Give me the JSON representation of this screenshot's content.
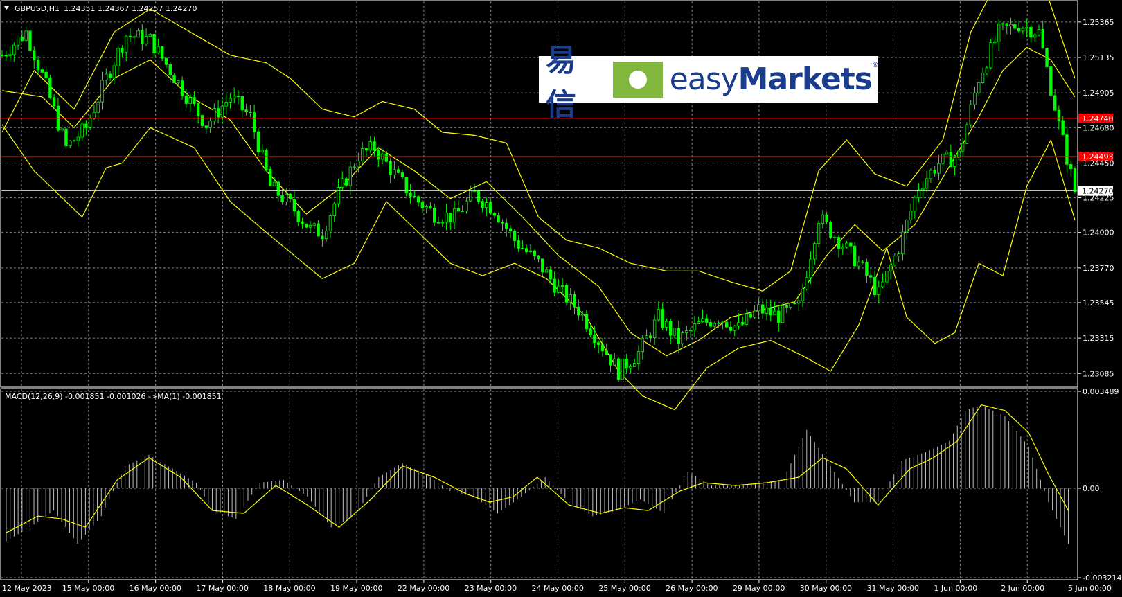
{
  "chart_data": [
    {
      "type": "candlestick",
      "symbol_header": "GBPUSD,H1",
      "ohlc": "1.24351 1.24367 1.24257 1.24270",
      "y_ticks": [
        "1.25365",
        "1.25135",
        "1.24905",
        "1.24680",
        "1.24450",
        "1.24225",
        "1.24000",
        "1.23770",
        "1.23545",
        "1.23315",
        "1.23085"
      ],
      "ylim": [
        1.2301,
        1.2549
      ],
      "x_ticks": [
        "12 May 2023",
        "15 May 00:00",
        "16 May 00:00",
        "17 May 00:00",
        "18 May 00:00",
        "19 May 00:00",
        "22 May 00:00",
        "23 May 00:00",
        "24 May 00:00",
        "25 May 00:00",
        "26 May 00:00",
        "29 May 00:00",
        "30 May 00:00",
        "31 May 00:00",
        "1 Jun 00:00",
        "2 Jun 00:00",
        "5 Jun 00:00"
      ],
      "hlines": [
        {
          "value": 1.2474,
          "label": "1.24740",
          "color": "#ff0000"
        },
        {
          "value": 1.24493,
          "label": "1.24493",
          "color": "#ff0000"
        },
        {
          "value": 1.2427,
          "label": "1.24270",
          "color": "#c0c0c0"
        }
      ],
      "close_path": [
        [
          0,
          1.2515
        ],
        [
          6,
          1.253
        ],
        [
          11,
          1.2495
        ],
        [
          16,
          1.2455
        ],
        [
          21,
          1.2468
        ],
        [
          26,
          1.25
        ],
        [
          31,
          1.2528
        ],
        [
          37,
          1.2525
        ],
        [
          42,
          1.2505
        ],
        [
          47,
          1.2485
        ],
        [
          51,
          1.247
        ],
        [
          57,
          1.2488
        ],
        [
          62,
          1.2475
        ],
        [
          67,
          1.243
        ],
        [
          72,
          1.2418
        ],
        [
          77,
          1.2402
        ],
        [
          80,
          1.24
        ],
        [
          84,
          1.2425
        ],
        [
          89,
          1.245
        ],
        [
          93,
          1.2455
        ],
        [
          98,
          1.2438
        ],
        [
          103,
          1.2422
        ],
        [
          108,
          1.2412
        ],
        [
          113,
          1.241
        ],
        [
          118,
          1.2425
        ],
        [
          123,
          1.2415
        ],
        [
          128,
          1.2395
        ],
        [
          134,
          1.238
        ],
        [
          139,
          1.2363
        ],
        [
          144,
          1.235
        ],
        [
          149,
          1.233
        ],
        [
          154,
          1.231
        ],
        [
          159,
          1.2322
        ],
        [
          164,
          1.2345
        ],
        [
          169,
          1.233
        ],
        [
          174,
          1.234
        ],
        [
          179,
          1.2345
        ],
        [
          184,
          1.2338
        ],
        [
          189,
          1.235
        ],
        [
          194,
          1.2346
        ],
        [
          199,
          1.2352
        ],
        [
          204,
          1.241
        ],
        [
          209,
          1.2395
        ],
        [
          214,
          1.238
        ],
        [
          219,
          1.236
        ],
        [
          224,
          1.239
        ],
        [
          229,
          1.243
        ],
        [
          234,
          1.2445
        ],
        [
          239,
          1.245
        ],
        [
          244,
          1.25
        ],
        [
          249,
          1.253
        ],
        [
          254,
          1.2535
        ],
        [
          259,
          1.253
        ],
        [
          264,
          1.247
        ],
        [
          268,
          1.2427
        ]
      ],
      "bb_upper": [
        [
          0,
          1.2465
        ],
        [
          8,
          1.2505
        ],
        [
          18,
          1.248
        ],
        [
          28,
          1.253
        ],
        [
          37,
          1.2545
        ],
        [
          47,
          1.253
        ],
        [
          57,
          1.2515
        ],
        [
          66,
          1.251
        ],
        [
          72,
          1.25
        ],
        [
          80,
          1.248
        ],
        [
          88,
          1.2475
        ],
        [
          95,
          1.2485
        ],
        [
          103,
          1.248
        ],
        [
          110,
          1.2465
        ],
        [
          118,
          1.2463
        ],
        [
          126,
          1.2458
        ],
        [
          134,
          1.241
        ],
        [
          141,
          1.2395
        ],
        [
          149,
          1.239
        ],
        [
          157,
          1.238
        ],
        [
          166,
          1.2375
        ],
        [
          174,
          1.2375
        ],
        [
          182,
          1.2368
        ],
        [
          190,
          1.2362
        ],
        [
          197,
          1.2375
        ],
        [
          204,
          1.244
        ],
        [
          211,
          1.246
        ],
        [
          218,
          1.2438
        ],
        [
          226,
          1.243
        ],
        [
          235,
          1.246
        ],
        [
          242,
          1.253
        ],
        [
          248,
          1.256
        ],
        [
          255,
          1.258
        ],
        [
          261,
          1.2555
        ],
        [
          268,
          1.25
        ]
      ],
      "bb_middle": [
        [
          0,
          1.2492
        ],
        [
          10,
          1.2488
        ],
        [
          18,
          1.2468
        ],
        [
          28,
          1.25
        ],
        [
          37,
          1.2512
        ],
        [
          47,
          1.2488
        ],
        [
          57,
          1.2473
        ],
        [
          66,
          1.244
        ],
        [
          76,
          1.2412
        ],
        [
          85,
          1.243
        ],
        [
          94,
          1.2455
        ],
        [
          103,
          1.244
        ],
        [
          112,
          1.2422
        ],
        [
          121,
          1.2433
        ],
        [
          130,
          1.241
        ],
        [
          139,
          1.2385
        ],
        [
          149,
          1.2365
        ],
        [
          157,
          1.2335
        ],
        [
          166,
          1.232
        ],
        [
          174,
          1.233
        ],
        [
          182,
          1.2345
        ],
        [
          190,
          1.235
        ],
        [
          198,
          1.2355
        ],
        [
          206,
          1.2385
        ],
        [
          213,
          1.2405
        ],
        [
          220,
          1.2388
        ],
        [
          228,
          1.2405
        ],
        [
          236,
          1.244
        ],
        [
          244,
          1.2475
        ],
        [
          250,
          1.2505
        ],
        [
          256,
          1.252
        ],
        [
          262,
          1.2512
        ],
        [
          268,
          1.2488
        ]
      ],
      "bb_lower": [
        [
          0,
          1.247
        ],
        [
          8,
          1.244
        ],
        [
          20,
          1.241
        ],
        [
          26,
          1.2442
        ],
        [
          30,
          1.2445
        ],
        [
          37,
          1.2468
        ],
        [
          48,
          1.2455
        ],
        [
          57,
          1.242
        ],
        [
          66,
          1.24
        ],
        [
          80,
          1.237
        ],
        [
          88,
          1.238
        ],
        [
          96,
          1.242
        ],
        [
          104,
          1.24
        ],
        [
          112,
          1.238
        ],
        [
          120,
          1.2372
        ],
        [
          128,
          1.238
        ],
        [
          136,
          1.237
        ],
        [
          146,
          1.2345
        ],
        [
          154,
          1.231
        ],
        [
          160,
          1.2294
        ],
        [
          168,
          1.2285
        ],
        [
          176,
          1.2312
        ],
        [
          184,
          1.2325
        ],
        [
          192,
          1.233
        ],
        [
          200,
          1.232
        ],
        [
          207,
          1.231
        ],
        [
          214,
          1.234
        ],
        [
          221,
          1.239
        ],
        [
          226,
          1.2345
        ],
        [
          233,
          1.2328
        ],
        [
          238,
          1.2335
        ],
        [
          244,
          1.238
        ],
        [
          250,
          1.2372
        ],
        [
          256,
          1.243
        ],
        [
          262,
          1.246
        ],
        [
          268,
          1.2408
        ]
      ]
    },
    {
      "type": "histogram",
      "label": "MACD(12,26,9) -0.001851 -0.001026  ->MA(1) -0.001851",
      "y_ticks": [
        "0.003489",
        "0.00",
        "-0.003214"
      ],
      "ylim": [
        -0.003214,
        0.003489
      ],
      "macd": [
        [
          0,
          -0.0019
        ],
        [
          6,
          -0.0014
        ],
        [
          12,
          -0.0008
        ],
        [
          18,
          -0.002
        ],
        [
          24,
          -0.001
        ],
        [
          30,
          0.0008
        ],
        [
          36,
          0.0012
        ],
        [
          42,
          0.0007
        ],
        [
          48,
          0.0002
        ],
        [
          52,
          -0.0008
        ],
        [
          58,
          -0.0011
        ],
        [
          64,
          0.0002
        ],
        [
          70,
          0.0003
        ],
        [
          76,
          -0.0003
        ],
        [
          82,
          -0.0014
        ],
        [
          88,
          -0.001
        ],
        [
          94,
          0.0004
        ],
        [
          100,
          0.0009
        ],
        [
          106,
          0.0005
        ],
        [
          112,
          -0.0001
        ],
        [
          118,
          -0.0003
        ],
        [
          124,
          -0.0009
        ],
        [
          130,
          -0.0003
        ],
        [
          136,
          0.0004
        ],
        [
          142,
          -0.0005
        ],
        [
          148,
          -0.001
        ],
        [
          154,
          -0.0008
        ],
        [
          160,
          -0.0004
        ],
        [
          166,
          -0.0009
        ],
        [
          172,
          0.0006
        ],
        [
          178,
          0.0001
        ],
        [
          184,
          0.0001
        ],
        [
          190,
          0.0002
        ],
        [
          196,
          0.0003
        ],
        [
          202,
          0.0021
        ],
        [
          208,
          0.0008
        ],
        [
          214,
          -0.0005
        ],
        [
          220,
          -0.0005
        ],
        [
          226,
          0.001
        ],
        [
          232,
          0.0013
        ],
        [
          238,
          0.0017
        ],
        [
          242,
          0.0028
        ],
        [
          246,
          0.003
        ],
        [
          252,
          0.0026
        ],
        [
          258,
          0.0015
        ],
        [
          263,
          -0.0005
        ],
        [
          268,
          -0.002
        ]
      ],
      "signal": [
        [
          0,
          -0.0016
        ],
        [
          8,
          -0.001
        ],
        [
          14,
          -0.0011
        ],
        [
          20,
          -0.0014
        ],
        [
          28,
          0.0003
        ],
        [
          36,
          0.0011
        ],
        [
          44,
          0.0004
        ],
        [
          52,
          -0.0008
        ],
        [
          60,
          -0.0009
        ],
        [
          68,
          0.0001
        ],
        [
          76,
          -0.0006
        ],
        [
          84,
          -0.0014
        ],
        [
          92,
          -0.0004
        ],
        [
          100,
          0.0008
        ],
        [
          108,
          0.0004
        ],
        [
          116,
          -0.0002
        ],
        [
          122,
          -0.0005
        ],
        [
          128,
          -0.0003
        ],
        [
          134,
          0.0004
        ],
        [
          142,
          -0.0006
        ],
        [
          150,
          -0.0009
        ],
        [
          156,
          -0.0007
        ],
        [
          162,
          -0.0008
        ],
        [
          170,
          -0.0001
        ],
        [
          176,
          0.0002
        ],
        [
          184,
          0.0001
        ],
        [
          192,
          0.0002
        ],
        [
          200,
          0.0004
        ],
        [
          206,
          0.0011
        ],
        [
          212,
          0.0007
        ],
        [
          220,
          -0.0006
        ],
        [
          228,
          0.0007
        ],
        [
          234,
          0.0011
        ],
        [
          240,
          0.0017
        ],
        [
          246,
          0.003
        ],
        [
          252,
          0.0028
        ],
        [
          258,
          0.002
        ],
        [
          263,
          0.0005
        ],
        [
          268,
          -0.0008
        ]
      ]
    }
  ],
  "logo": {
    "cn_text": "易信",
    "en_light": "easy",
    "en_bold": "Markets",
    "reg_mark": "®"
  },
  "colors": {
    "background": "#000000",
    "candle": "#00ff00",
    "bands": "#ffff00",
    "grid": "#c0c0c0",
    "hline_red": "#ff0000",
    "macd_hist": "#c0c0c0",
    "signal": "#ffff00",
    "logo_blue": "#1a3c8c",
    "logo_green": "#7fb83d"
  }
}
